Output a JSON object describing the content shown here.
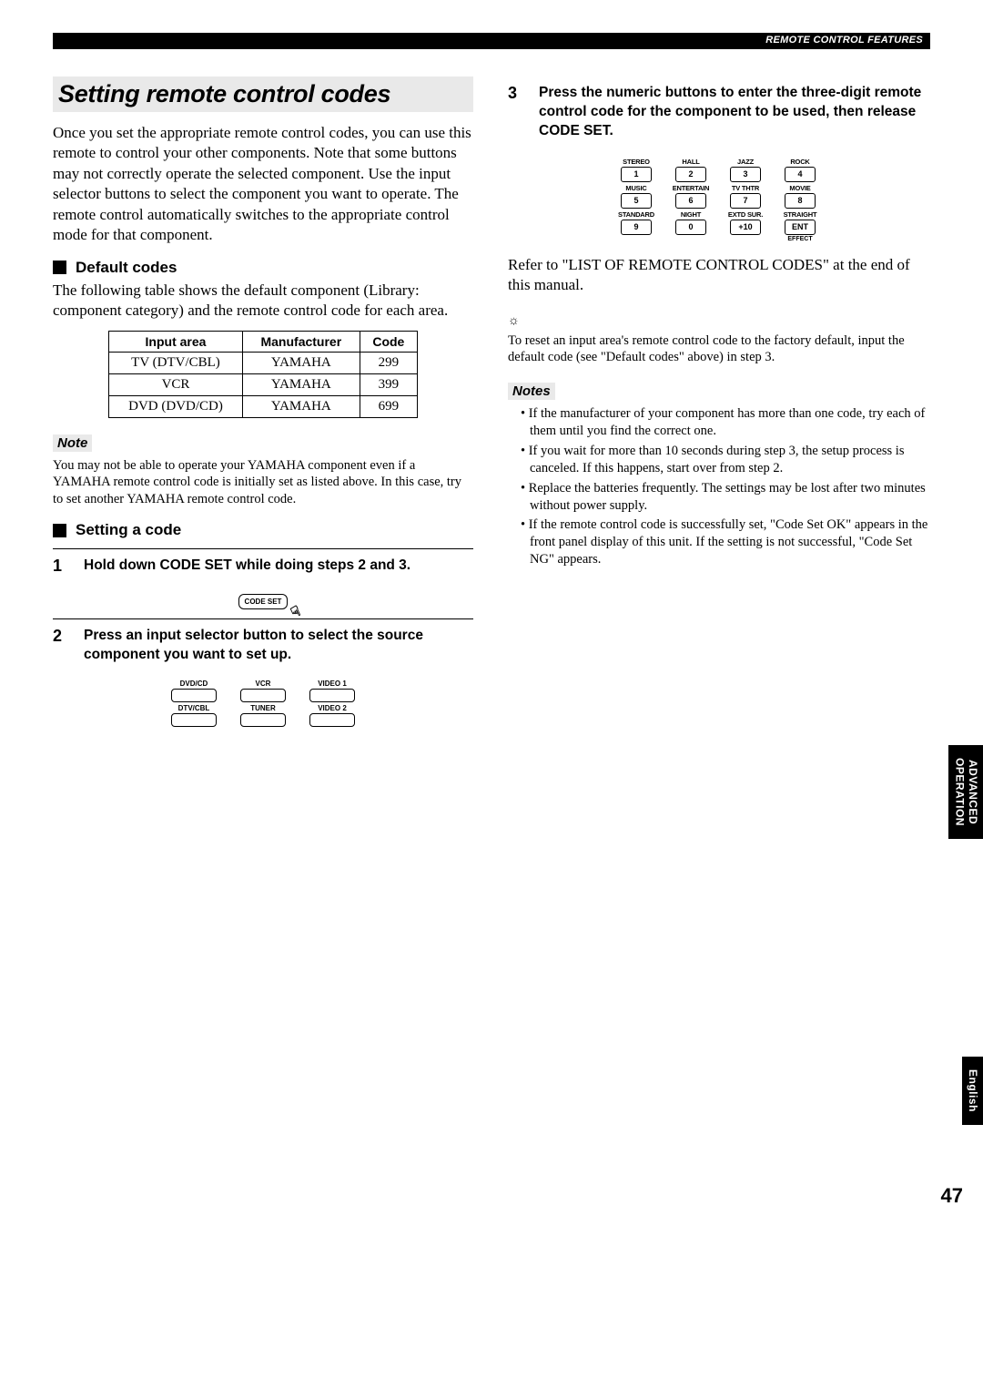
{
  "header": {
    "breadcrumb": "REMOTE CONTROL FEATURES"
  },
  "title": "Setting remote control codes",
  "intro": "Once you set the appropriate remote control codes, you can use this remote to control your other components. Note that some buttons may not correctly operate the selected component. Use the input selector buttons to select the component you want to operate. The remote control automatically switches to the appropriate control mode for that component.",
  "default_codes": {
    "heading": "Default codes",
    "desc": "The following table shows the default component (Library: component category) and the remote control code for each area.",
    "cols": {
      "c1": "Input area",
      "c2": "Manufacturer",
      "c3": "Code"
    },
    "rows": [
      {
        "area": "TV (DTV/CBL)",
        "mfr": "YAMAHA",
        "code": "299"
      },
      {
        "area": "VCR",
        "mfr": "YAMAHA",
        "code": "399"
      },
      {
        "area": "DVD (DVD/CD)",
        "mfr": "YAMAHA",
        "code": "699"
      }
    ]
  },
  "note1": {
    "label": "Note",
    "text": "You may not be able to operate your YAMAHA component even if a YAMAHA remote control code is initially set as listed above. In this case, try to set another YAMAHA remote control code."
  },
  "setting": {
    "heading": "Setting a code",
    "step1": {
      "num": "1",
      "text": "Hold down CODE SET while doing steps 2 and 3.",
      "btn": "CODE SET"
    },
    "step2": {
      "num": "2",
      "text": "Press an input selector button to select the source component you want to set up.",
      "labels": [
        "DVD/CD",
        "VCR",
        "VIDEO 1",
        "DTV/CBL",
        "TUNER",
        "VIDEO 2"
      ]
    },
    "step3": {
      "num": "3",
      "text": "Press the numeric buttons to enter the three-digit remote control code for the component to be used, then release CODE SET.",
      "keypad": [
        {
          "label": "STEREO",
          "key": "1"
        },
        {
          "label": "HALL",
          "key": "2"
        },
        {
          "label": "JAZZ",
          "key": "3"
        },
        {
          "label": "ROCK",
          "key": "4"
        },
        {
          "label": "MUSIC",
          "key": "5"
        },
        {
          "label": "ENTERTAIN",
          "key": "6"
        },
        {
          "label": "TV THTR",
          "key": "7"
        },
        {
          "label": "MOVIE",
          "key": "8"
        },
        {
          "label": "STANDARD",
          "key": "9"
        },
        {
          "label": "NIGHT",
          "key": "0"
        },
        {
          "label": "EXTD SUR.",
          "key": "+10"
        },
        {
          "label": "STRAIGHT",
          "key": "ENT",
          "sub": "EFFECT"
        }
      ],
      "refer": "Refer to \"LIST OF REMOTE CONTROL CODES\" at the end of this manual.",
      "tip": "To reset an input area's remote control code to the factory default, input the default code (see \"Default codes\" above) in step 3."
    }
  },
  "notes2": {
    "label": "Notes",
    "items": [
      "If the manufacturer of your component has more than one code, try each of them until you find the correct one.",
      "If you wait for more than 10 seconds during step 3, the setup process is canceled. If this happens, start over from step 2.",
      "Replace the batteries frequently. The settings may be lost after two minutes without power supply.",
      "If the remote control code is successfully set, \"Code Set OK\" appears in the front panel display of this unit. If the setting is not successful, \"Code Set NG\" appears."
    ]
  },
  "side": {
    "adv1": "ADVANCED",
    "adv2": "OPERATION",
    "eng": "English"
  },
  "page_num": "47"
}
